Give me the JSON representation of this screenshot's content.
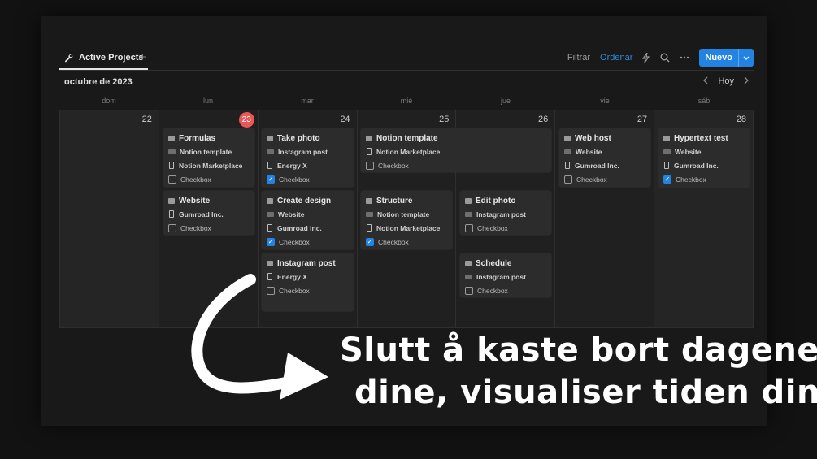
{
  "header": {
    "tab_label": "Active Projects",
    "tab_add": "+",
    "filter_label": "Filtrar",
    "sort_label": "Ordenar",
    "new_label": "Nuevo"
  },
  "calendar": {
    "month": "octubre de 2023",
    "today_label": "Hoy",
    "weekdays": [
      "dom",
      "lun",
      "mar",
      "mié",
      "jue",
      "vie",
      "sáb"
    ],
    "days": [
      "22",
      "23",
      "24",
      "25",
      "26",
      "27",
      "28"
    ]
  },
  "cards": [
    {
      "title": "Formulas",
      "category": "Notion template",
      "client": "Notion Marketplace",
      "checkbox": "Checkbox",
      "checked": false
    },
    {
      "title": "Website",
      "category": "",
      "client": "Gumroad Inc.",
      "checkbox": "Checkbox",
      "checked": false
    },
    {
      "title": "Take photo",
      "category": "Instagram post",
      "client": "Energy X",
      "checkbox": "Checkbox",
      "checked": true
    },
    {
      "title": "Create design",
      "category": "Website",
      "client": "Gumroad Inc.",
      "checkbox": "Checkbox",
      "checked": true
    },
    {
      "title": "Instagram post",
      "category": "",
      "client": "Energy X",
      "checkbox": "Checkbox",
      "checked": false
    },
    {
      "title": "Notion template",
      "category": "",
      "client": "Notion Marketplace",
      "checkbox": "Checkbox",
      "checked": false
    },
    {
      "title": "Structure",
      "category": "Notion template",
      "client": "Notion Marketplace",
      "checkbox": "Checkbox",
      "checked": true
    },
    {
      "title": "Edit photo",
      "category": "Instagram post",
      "client": "",
      "checkbox": "Checkbox",
      "checked": false
    },
    {
      "title": "Schedule",
      "category": "Instagram post",
      "client": "",
      "checkbox": "Checkbox",
      "checked": false
    },
    {
      "title": "Web host",
      "category": "Website",
      "client": "Gumroad Inc.",
      "checkbox": "Checkbox",
      "checked": false
    },
    {
      "title": "Hypertext test",
      "category": "Website",
      "client": "Gumroad Inc.",
      "checkbox": "Checkbox",
      "checked": true
    }
  ],
  "caption": {
    "line1": "Slutt å kaste bort dagene",
    "line2": "dine, visualiser tiden din"
  },
  "colors": {
    "accent": "#2383e2",
    "today": "#eb5757",
    "background": "#191919"
  }
}
